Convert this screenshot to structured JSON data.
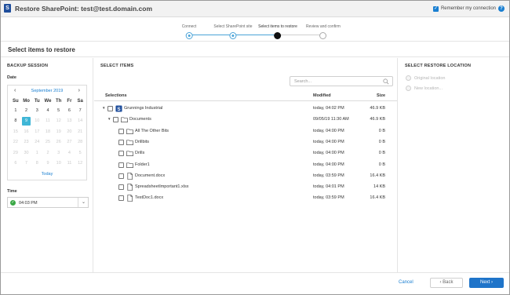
{
  "window": {
    "title": "Restore SharePoint: test@test.domain.com",
    "remember_label": "Remember my connection",
    "remember_checked": true
  },
  "stepper": {
    "steps": [
      {
        "label": "Connect",
        "state": "done"
      },
      {
        "label": "Select SharePoint site",
        "state": "done"
      },
      {
        "label": "Select items to restore",
        "state": "current"
      },
      {
        "label": "Review and confirm",
        "state": "todo"
      }
    ]
  },
  "section": {
    "title": "Select items to restore"
  },
  "backup_session": {
    "title": "BACKUP SESSION",
    "date_label": "Date",
    "calendar": {
      "month": "September 2019",
      "weekdays": [
        "Su",
        "Mo",
        "Tu",
        "We",
        "Th",
        "Fr",
        "Sa"
      ],
      "days": [
        {
          "d": "1",
          "s": "normal"
        },
        {
          "d": "2",
          "s": "normal"
        },
        {
          "d": "3",
          "s": "normal"
        },
        {
          "d": "4",
          "s": "normal"
        },
        {
          "d": "5",
          "s": "normal"
        },
        {
          "d": "6",
          "s": "normal"
        },
        {
          "d": "7",
          "s": "normal"
        },
        {
          "d": "8",
          "s": "normal"
        },
        {
          "d": "9",
          "s": "selected"
        },
        {
          "d": "10",
          "s": "dim"
        },
        {
          "d": "11",
          "s": "dim"
        },
        {
          "d": "12",
          "s": "dim"
        },
        {
          "d": "13",
          "s": "dim"
        },
        {
          "d": "14",
          "s": "dim"
        },
        {
          "d": "15",
          "s": "dim"
        },
        {
          "d": "16",
          "s": "dim"
        },
        {
          "d": "17",
          "s": "dim"
        },
        {
          "d": "18",
          "s": "dim"
        },
        {
          "d": "19",
          "s": "dim"
        },
        {
          "d": "20",
          "s": "dim"
        },
        {
          "d": "21",
          "s": "dim"
        },
        {
          "d": "22",
          "s": "dim"
        },
        {
          "d": "23",
          "s": "dim"
        },
        {
          "d": "24",
          "s": "dim"
        },
        {
          "d": "25",
          "s": "dim"
        },
        {
          "d": "26",
          "s": "dim"
        },
        {
          "d": "27",
          "s": "dim"
        },
        {
          "d": "28",
          "s": "dim"
        },
        {
          "d": "29",
          "s": "dim"
        },
        {
          "d": "30",
          "s": "dim"
        },
        {
          "d": "1",
          "s": "dim"
        },
        {
          "d": "2",
          "s": "dim"
        },
        {
          "d": "3",
          "s": "dim"
        },
        {
          "d": "4",
          "s": "dim"
        },
        {
          "d": "5",
          "s": "dim"
        },
        {
          "d": "6",
          "s": "dim"
        },
        {
          "d": "7",
          "s": "dim"
        },
        {
          "d": "8",
          "s": "dim"
        },
        {
          "d": "9",
          "s": "dim"
        },
        {
          "d": "10",
          "s": "dim"
        },
        {
          "d": "11",
          "s": "dim"
        },
        {
          "d": "12",
          "s": "dim"
        }
      ],
      "today_label": "Today"
    },
    "time_label": "Time",
    "time_value": "04:03 PM"
  },
  "select_items": {
    "title": "SELECT ITEMS",
    "search_placeholder": "Search...",
    "columns": {
      "selections": "Selections",
      "modified": "Modified",
      "size": "Size"
    },
    "rows": [
      {
        "name": "Grunnings Industrial",
        "type": "site",
        "level": 0,
        "expand": "down",
        "modified": "today, 04:02 PM",
        "size": "46.9 KB"
      },
      {
        "name": "Documents",
        "type": "folder",
        "level": 1,
        "expand": "down",
        "modified": "09/05/19 11:30 AM",
        "size": "46.9 KB"
      },
      {
        "name": "All The Other Bits",
        "type": "folder",
        "level": 2,
        "expand": "",
        "modified": "today, 04:00 PM",
        "size": "0 B"
      },
      {
        "name": "Drillbits",
        "type": "folder",
        "level": 2,
        "expand": "",
        "modified": "today, 04:00 PM",
        "size": "0 B"
      },
      {
        "name": "Drills",
        "type": "folder",
        "level": 2,
        "expand": "",
        "modified": "today, 04:00 PM",
        "size": "0 B"
      },
      {
        "name": "Folder1",
        "type": "folder",
        "level": 2,
        "expand": "",
        "modified": "today, 04:00 PM",
        "size": "0 B"
      },
      {
        "name": "Document.docx",
        "type": "file",
        "level": 2,
        "expand": "",
        "modified": "today, 03:59 PM",
        "size": "16.4 KB"
      },
      {
        "name": "SpreadsheetImportant1.xlsx",
        "type": "file",
        "level": 2,
        "expand": "",
        "modified": "today, 04:01 PM",
        "size": "14 KB"
      },
      {
        "name": "TestDoc1.docx",
        "type": "file",
        "level": 2,
        "expand": "",
        "modified": "today, 03:59 PM",
        "size": "16.4 KB"
      }
    ]
  },
  "restore_location": {
    "title": "SELECT RESTORE LOCATION",
    "options": [
      "Original location",
      "New location..."
    ]
  },
  "footer": {
    "cancel_label": "Cancel",
    "back_label": "Back",
    "next_label": "Next"
  },
  "colors": {
    "accent": "#1a7fd1",
    "selected_day": "#3fb6d6",
    "next_button": "#1f74c9",
    "success": "#3aa845"
  }
}
